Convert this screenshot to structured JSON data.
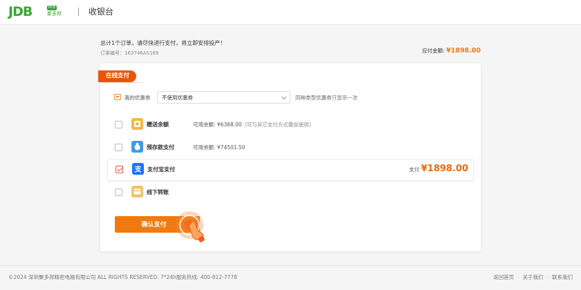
{
  "header": {
    "logo_text": "JDB",
    "logo_badge": "PCB",
    "logo_cn": "聚多邦",
    "title": "收银台"
  },
  "order": {
    "summary": "总计1个订单，请尽快进行支付，将立即安排投产！",
    "number": "订单编号：163746AS169",
    "amount_label": "应付金额:",
    "amount_value": "¥1898.00"
  },
  "payment": {
    "section_tag": "在线支付",
    "coupon": {
      "label": "我的优惠券",
      "selected": "不使用优惠券",
      "note": "同种类型优惠券只显示一次"
    },
    "methods": [
      {
        "name": "赠送余额",
        "icon": "gift-balance-icon",
        "checked": false,
        "balance": "可用余额: ¥6368.00",
        "note": "(可与其它支付方式叠加使用)"
      },
      {
        "name": "预存款支付",
        "icon": "deposit-icon",
        "checked": false,
        "balance": "可用余额: ¥74501.50",
        "note": ""
      },
      {
        "name": "支付宝支付",
        "icon": "alipay-icon",
        "checked": true,
        "pay_label": "支付",
        "pay_amount": "¥1898.00"
      },
      {
        "name": "线下转账",
        "icon": "offline-transfer-icon",
        "checked": false
      }
    ],
    "confirm_label": "确认支付"
  },
  "footer": {
    "copyright": "©2024 深圳聚多邦精密电路有限公司 ALL RIGHTS RESERVED. 7*24h服务热线: 400-812-7778",
    "links": [
      "返回首页",
      "关于我们",
      "联系我们"
    ]
  },
  "colors": {
    "brand_green": "#3aa533",
    "accent_orange": "#f07a10",
    "price_orange": "#ea6a0c",
    "alipay_blue": "#1677ff"
  }
}
